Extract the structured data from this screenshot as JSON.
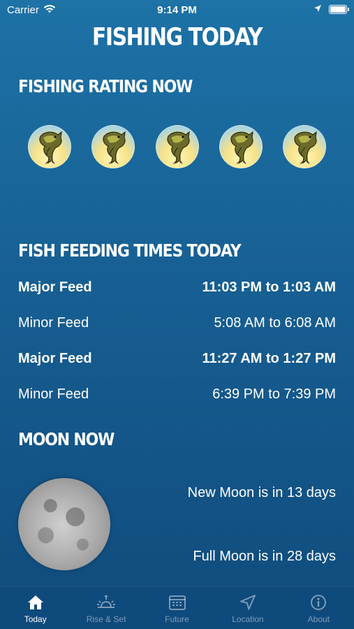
{
  "status_bar": {
    "carrier": "Carrier",
    "time": "9:14 PM",
    "icons": [
      "wifi-icon",
      "location-arrow-icon",
      "battery-icon"
    ]
  },
  "title": "FISHING TODAY",
  "rating": {
    "heading": "FISHING RATING NOW",
    "fish_count": 5,
    "max": 5,
    "icon": "bass-fish-icon"
  },
  "feeding": {
    "heading": "FISH FEEDING TIMES TODAY",
    "rows": [
      {
        "label": "Major Feed",
        "time": "11:03 PM to 1:03 AM",
        "bold": true
      },
      {
        "label": "Minor Feed",
        "time": "5:08 AM to 6:08 AM",
        "bold": false
      },
      {
        "label": "Major Feed",
        "time": "11:27 AM to 1:27 PM",
        "bold": true
      },
      {
        "label": "Minor Feed",
        "time": "6:39 PM to 7:39 PM",
        "bold": false
      }
    ]
  },
  "moon": {
    "heading": "MOON NOW",
    "new_moon": "New Moon is in 13 days",
    "full_moon": "Full Moon is in 28 days"
  },
  "tabs": [
    {
      "label": "Today",
      "icon": "home-icon",
      "active": true
    },
    {
      "label": "Rise & Set",
      "icon": "sunrise-icon",
      "active": false
    },
    {
      "label": "Future",
      "icon": "calendar-icon",
      "active": false
    },
    {
      "label": "Location",
      "icon": "location-arrow-icon",
      "active": false
    },
    {
      "label": "About",
      "icon": "info-icon",
      "active": false
    }
  ],
  "colors": {
    "background_top": "#1d72a6",
    "background_bottom": "#104b7c",
    "tab_bar": "#0f4a7c"
  }
}
